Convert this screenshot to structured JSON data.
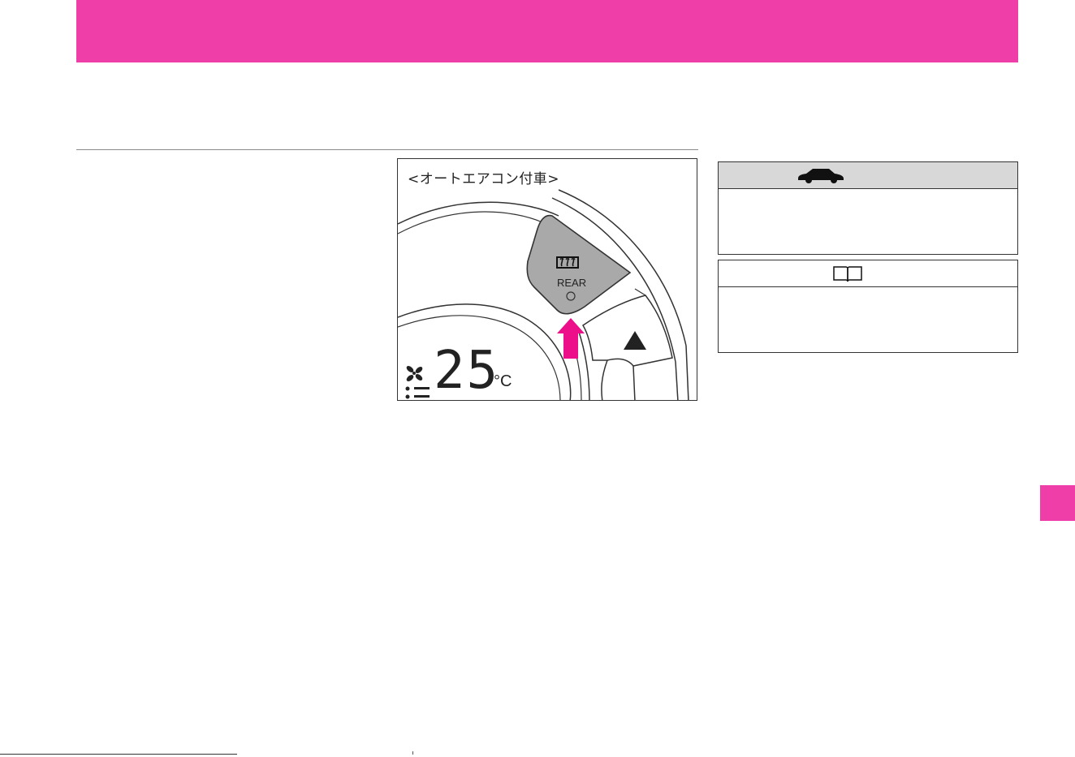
{
  "figure": {
    "caption": "<オートエアコン付車>",
    "button_label": "REAR",
    "temperature": "25",
    "unit": "°C",
    "icons": [
      "rear-defogger-icon",
      "indicator-lamp-icon",
      "up-arrow-icon",
      "fan-icon",
      "fan-level-icon"
    ]
  },
  "warning_box": {
    "icon": "car-icon"
  },
  "info_box": {
    "icon": "book-icon"
  },
  "colors": {
    "accent": "#f03ea8",
    "button_fill": "#a9a9a9",
    "warning_header": "#d8d8d8"
  }
}
